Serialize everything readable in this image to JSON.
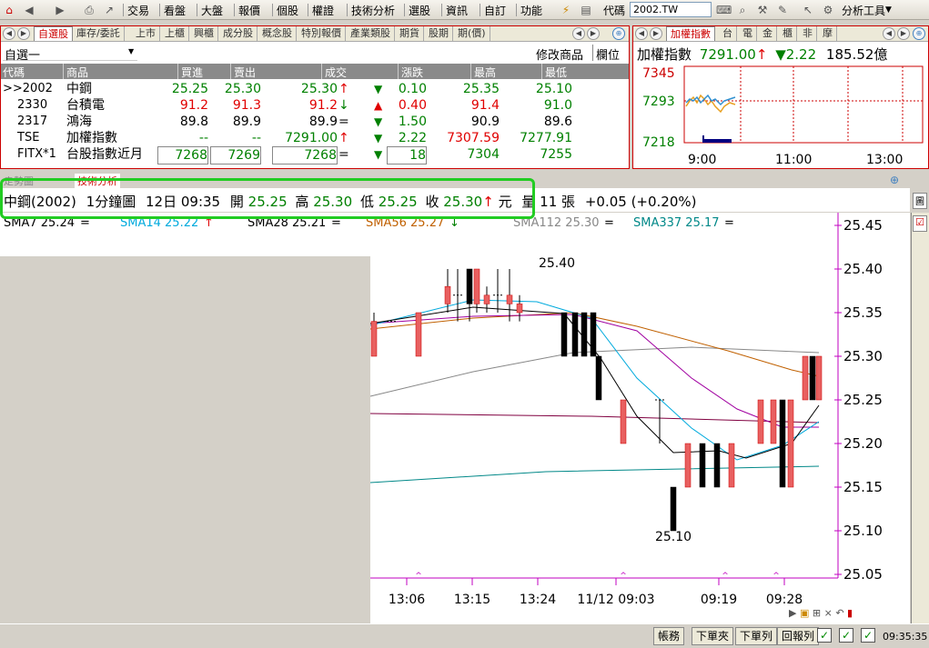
{
  "menubar": {
    "items": [
      "交易",
      "看盤",
      "大盤",
      "報價",
      "個股",
      "權證",
      "技術分析",
      "選股",
      "資訊",
      "自訂",
      "功能"
    ],
    "code_label": "代碼",
    "code_value": "2002.TW",
    "tools_label": "分析工具"
  },
  "quote_tabs": [
    "自選股",
    "庫存/委託",
    "上市",
    "上櫃",
    "興櫃",
    "成分股",
    "概念股",
    "特別報價",
    "產業類股",
    "期貨",
    "股期",
    "期(價)"
  ],
  "group_select": "自選一",
  "modify_btn": "修改商品",
  "column_btn": "欄位",
  "columns": [
    "代碼",
    "商品",
    "買進",
    "賣出",
    "成交",
    "漲跌",
    "最高",
    "最低"
  ],
  "rows": [
    {
      "code": ">>2002",
      "name": "中鋼",
      "bid": "25.25",
      "ask": "25.30",
      "last": "25.30",
      "last_mark": "↑",
      "chg": "0.10",
      "chg_dir": "down",
      "high": "25.35",
      "low": "25.10"
    },
    {
      "code": "2330",
      "name": "台積電",
      "bid": "91.2",
      "ask": "91.3",
      "last": "91.2",
      "last_mark": "↓",
      "chg": "0.40",
      "chg_dir": "up",
      "high": "91.4",
      "low": "91.0"
    },
    {
      "code": "2317",
      "name": "鴻海",
      "bid": "89.8",
      "ask": "89.9",
      "last": "89.9",
      "last_mark": "=",
      "chg": "1.50",
      "chg_dir": "down",
      "high": "90.9",
      "low": "89.6"
    },
    {
      "code": "TSE",
      "name": "加權指數",
      "bid": "--",
      "ask": "--",
      "last": "7291.00",
      "last_mark": "↑",
      "chg": "2.22",
      "chg_dir": "down",
      "high": "7307.59",
      "low": "7277.91"
    },
    {
      "code": "FITX*1",
      "name": "台股指數近月",
      "bid": "7268",
      "ask": "7269",
      "last": "7268",
      "last_mark": "=",
      "chg": "18",
      "chg_dir": "down",
      "high": "7304",
      "low": "7255"
    }
  ],
  "index_tabs": [
    "加權指數",
    "台",
    "電",
    "金",
    "櫃",
    "非",
    "摩"
  ],
  "index": {
    "name": "加權指數",
    "value": "7291.00",
    "arrow": "↑",
    "chg": "2.22",
    "amount": "185.52億",
    "y_ticks": [
      "7345",
      "7293",
      "7218"
    ],
    "x_ticks": [
      "9:00",
      "11:00",
      "13:00"
    ]
  },
  "section_tabs": [
    "走勢圖",
    "技術分析"
  ],
  "info": {
    "stock": "中鋼(2002)",
    "period": "1分鐘圖",
    "date": "12日 09:35",
    "open_label": "開",
    "open": "25.25",
    "high_label": "高",
    "high": "25.30",
    "low_label": "低",
    "low": "25.25",
    "close_label": "收",
    "close": "25.30",
    "close_mark": "↑",
    "unit": "元",
    "vol_label": "量",
    "vol": "11",
    "vol_unit": "張",
    "change": "+0.05 (+0.20%)"
  },
  "sma": [
    {
      "label": "SMA7 25.24",
      "mark": "=",
      "color": "#000000"
    },
    {
      "label": "SMA14 25.22",
      "mark": "↑",
      "color": "#00aadd"
    },
    {
      "label": "SMA28 25.21",
      "mark": "=",
      "color": "#000000"
    },
    {
      "label": "SMA56 25.27",
      "mark": "↓",
      "color": "#c06000"
    },
    {
      "label": "SMA112 25.30",
      "mark": "=",
      "color": "#888888"
    },
    {
      "label": "SMA337 25.17",
      "mark": "=",
      "color": "#008888"
    }
  ],
  "chart_data": {
    "type": "candlestick",
    "y_ticks": [
      "25.45",
      "25.40",
      "25.35",
      "25.30",
      "25.25",
      "25.20",
      "25.15",
      "25.10",
      "25.05"
    ],
    "x_ticks": [
      "13:06",
      "13:15",
      "13:24",
      "11/12 09:03",
      "09:19",
      "09:28"
    ],
    "annotations": [
      "25.40",
      "25.10"
    ],
    "ylim": [
      25.05,
      25.45
    ]
  },
  "status": {
    "buttons": [
      "帳務",
      "下單夾",
      "下單列",
      "回報列"
    ],
    "time": "09:35:35"
  }
}
